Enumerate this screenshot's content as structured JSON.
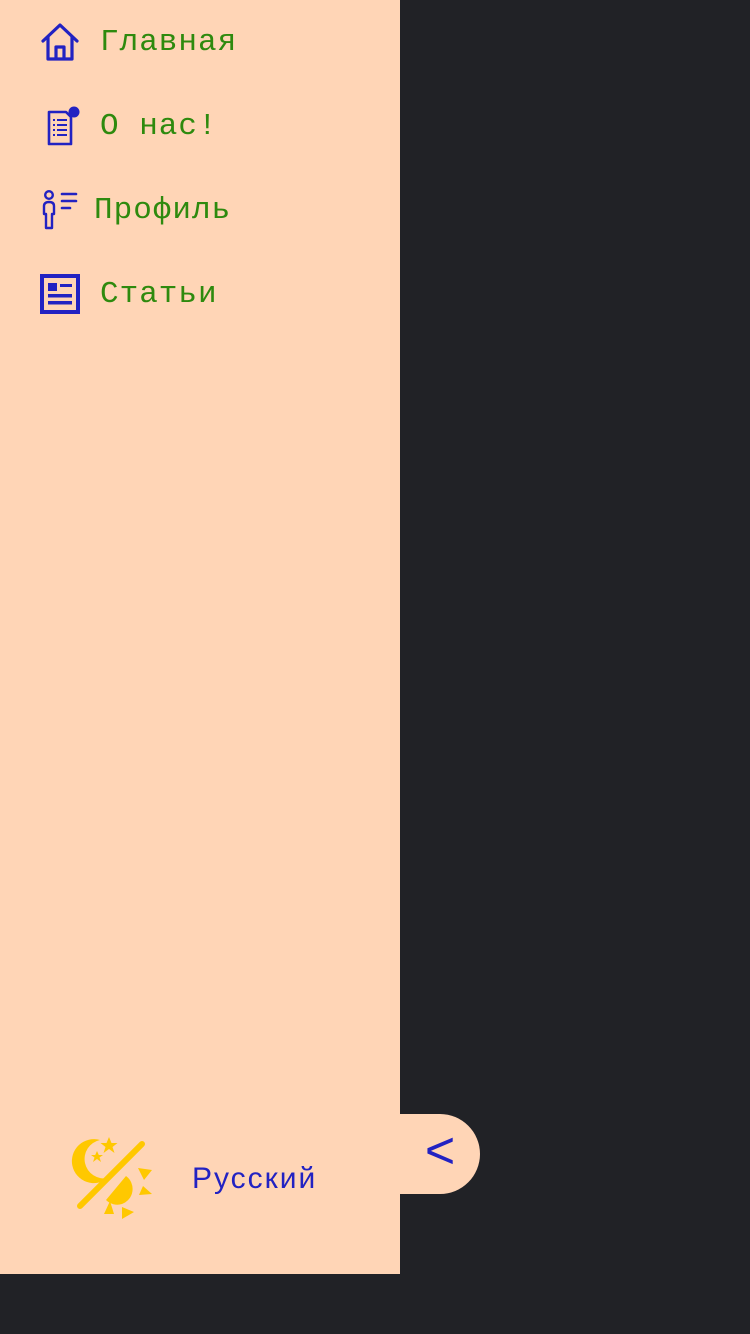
{
  "sidebar": {
    "items": [
      {
        "label": "Главная",
        "icon": "home-icon"
      },
      {
        "label": "О нас!",
        "icon": "about-document-icon"
      },
      {
        "label": "Профиль",
        "icon": "profile-icon"
      },
      {
        "label": "Статьи",
        "icon": "articles-icon"
      }
    ],
    "theme_icon": "theme-switch-icon",
    "language_label": "Русский",
    "collapse_label": "<"
  },
  "colors": {
    "sidebar_background": "#ffd5b6",
    "page_background": "#212226",
    "nav_text": "#2e8a0e",
    "icon_blue": "#2222c2",
    "theme_icon_yellow": "#ffc800"
  }
}
